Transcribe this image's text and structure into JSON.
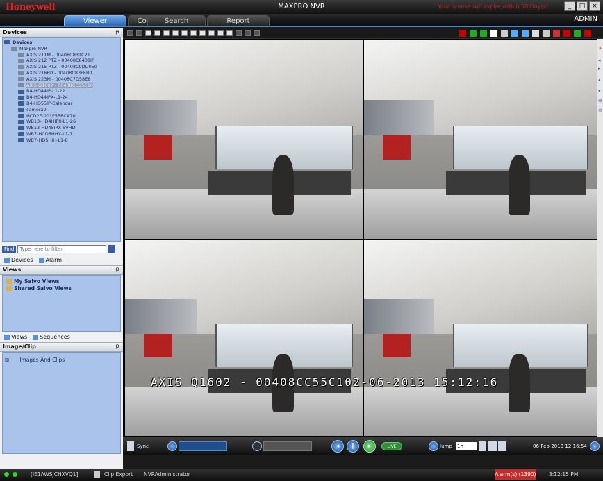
{
  "app": {
    "logo": "Honeywell",
    "title": "MAXPRO NVR",
    "license": "Your license will expire within 58 Day(s)",
    "user": "ADMIN"
  },
  "tabs": [
    {
      "label": "Viewer"
    },
    {
      "label": "Configurator"
    },
    {
      "label": "Search"
    },
    {
      "label": "Report"
    }
  ],
  "devices_panel": {
    "header": "Devices",
    "root": "Devices",
    "nvr": "Maxpro NVR",
    "items": [
      "AXIS 211M - 00408C831C21",
      "AXIS 212 PTZ - 00408C8408IP",
      "AXIS 215 PTZ - 00408C9DD0E9",
      "AXIS 216FD - 00408C83FEB0",
      "AXIS 223M - 00408C7D58E8",
      "AXIS Q1602 - 00408CC55C10",
      "B4-HD44IP-L1-22",
      "B4-HD44IPX-L1-24",
      "B4-HD55IP-Calendar",
      "camera9",
      "HCD2F-001F55BCA70",
      "WB13-HD4HIPX-L1-26",
      "WB13-HD45IPX-SVHD",
      "WB7-HCD5HHX-L1-7",
      "WB7-HD5HIH-L1-8"
    ],
    "selected_index": 5,
    "find_label": "Find",
    "find_placeholder": "Type here to filter",
    "subtabs": [
      "Devices",
      "Alarm"
    ]
  },
  "views_panel": {
    "header": "Views",
    "items": [
      "My Salvo Views",
      "Shared Salvo Views"
    ],
    "subtabs": [
      "Views",
      "Sequences"
    ]
  },
  "image_panel": {
    "header": "Image/Clip",
    "items": [
      "Images And Clips"
    ]
  },
  "video": {
    "osd_text": "AXIS Q1602 - 00408CC55C102-06-2013 15:12:16"
  },
  "playbar": {
    "sync": "Sync",
    "live": "LIVE",
    "jump": "Jump",
    "jump_value": "1h",
    "datetime": "06-Feb-2013 12:16:54"
  },
  "status": {
    "machine": "[IE1AWSJCHXVQ1]",
    "clip_export": "Clip Export",
    "user": "NVRAdministrator",
    "alarms": "Alarm(s) (1390)",
    "time": "3:12:15 PM"
  },
  "colors": {
    "accent": "#2d68b4",
    "panel": "#a9c3ea",
    "alarm": "#c62b2b",
    "live": "#2f8f3a"
  }
}
